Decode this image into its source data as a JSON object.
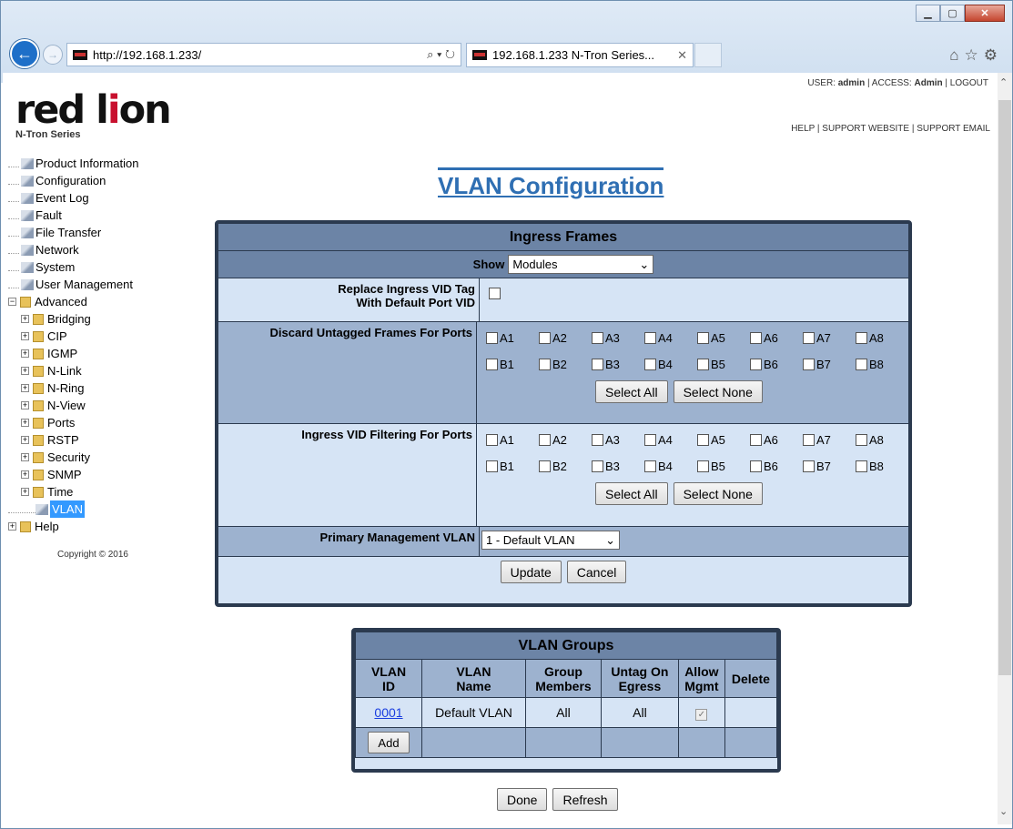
{
  "browser": {
    "url": "http://192.168.1.233/",
    "tab_title": "192.168.1.233 N-Tron Series...",
    "tab_close": "✕",
    "address_tools": "⌕ ▾ ↻"
  },
  "header": {
    "logo_text_pre": "red l",
    "logo_text_i": "i",
    "logo_text_post": "on",
    "logo_sub": "N-Tron Series",
    "user_label": "USER: ",
    "user": "admin",
    "access_label": " | ACCESS: ",
    "access": "Admin",
    "logout": " | LOGOUT",
    "help": "HELP",
    "support_website": "SUPPORT WEBSITE",
    "support_email": "SUPPORT EMAIL",
    "sep": " | "
  },
  "tree": {
    "items": [
      "Product Information",
      "Configuration",
      "Event Log",
      "Fault",
      "File Transfer",
      "Network",
      "System",
      "User Management"
    ],
    "advanced": "Advanced",
    "advanced_items": [
      "Bridging",
      "CIP",
      "IGMP",
      "N-Link",
      "N-Ring",
      "N-View",
      "Ports",
      "RSTP",
      "Security",
      "SNMP",
      "Time"
    ],
    "vlan": "VLAN",
    "help": "Help",
    "copyright": "Copyright © 2016"
  },
  "page": {
    "title": "VLAN Configuration"
  },
  "ingress": {
    "title": "Ingress Frames",
    "show_label": "Show",
    "show_value": "Modules",
    "replace_label_1": "Replace Ingress VID Tag",
    "replace_label_2": "With Default Port VID",
    "discard_label": "Discard Untagged Frames For Ports",
    "filter_label": "Ingress VID Filtering For Ports",
    "ports": [
      "A1",
      "A2",
      "A3",
      "A4",
      "A5",
      "A6",
      "A7",
      "A8",
      "B1",
      "B2",
      "B3",
      "B4",
      "B5",
      "B6",
      "B7",
      "B8"
    ],
    "select_all": "Select All",
    "select_none": "Select None",
    "pmvlan_label": "Primary Management VLAN",
    "pmvlan_value": "1 - Default VLAN",
    "update": "Update",
    "cancel": "Cancel"
  },
  "groups": {
    "title": "VLAN Groups",
    "cols": [
      [
        "VLAN",
        "ID"
      ],
      [
        "VLAN",
        "Name"
      ],
      [
        "Group",
        "Members"
      ],
      [
        "Untag On",
        "Egress"
      ],
      [
        "Allow",
        "Mgmt"
      ],
      [
        "Delete",
        ""
      ]
    ],
    "rows": [
      {
        "id": "0001",
        "name": "Default VLAN",
        "members": "All",
        "untag": "All",
        "allow_mgmt": true
      }
    ],
    "add": "Add"
  },
  "footer": {
    "done": "Done",
    "refresh": "Refresh"
  },
  "colors": {
    "header_blue": "#6c84a6",
    "body_blue": "#d6e4f5",
    "title_blue": "#2f6fb3"
  }
}
